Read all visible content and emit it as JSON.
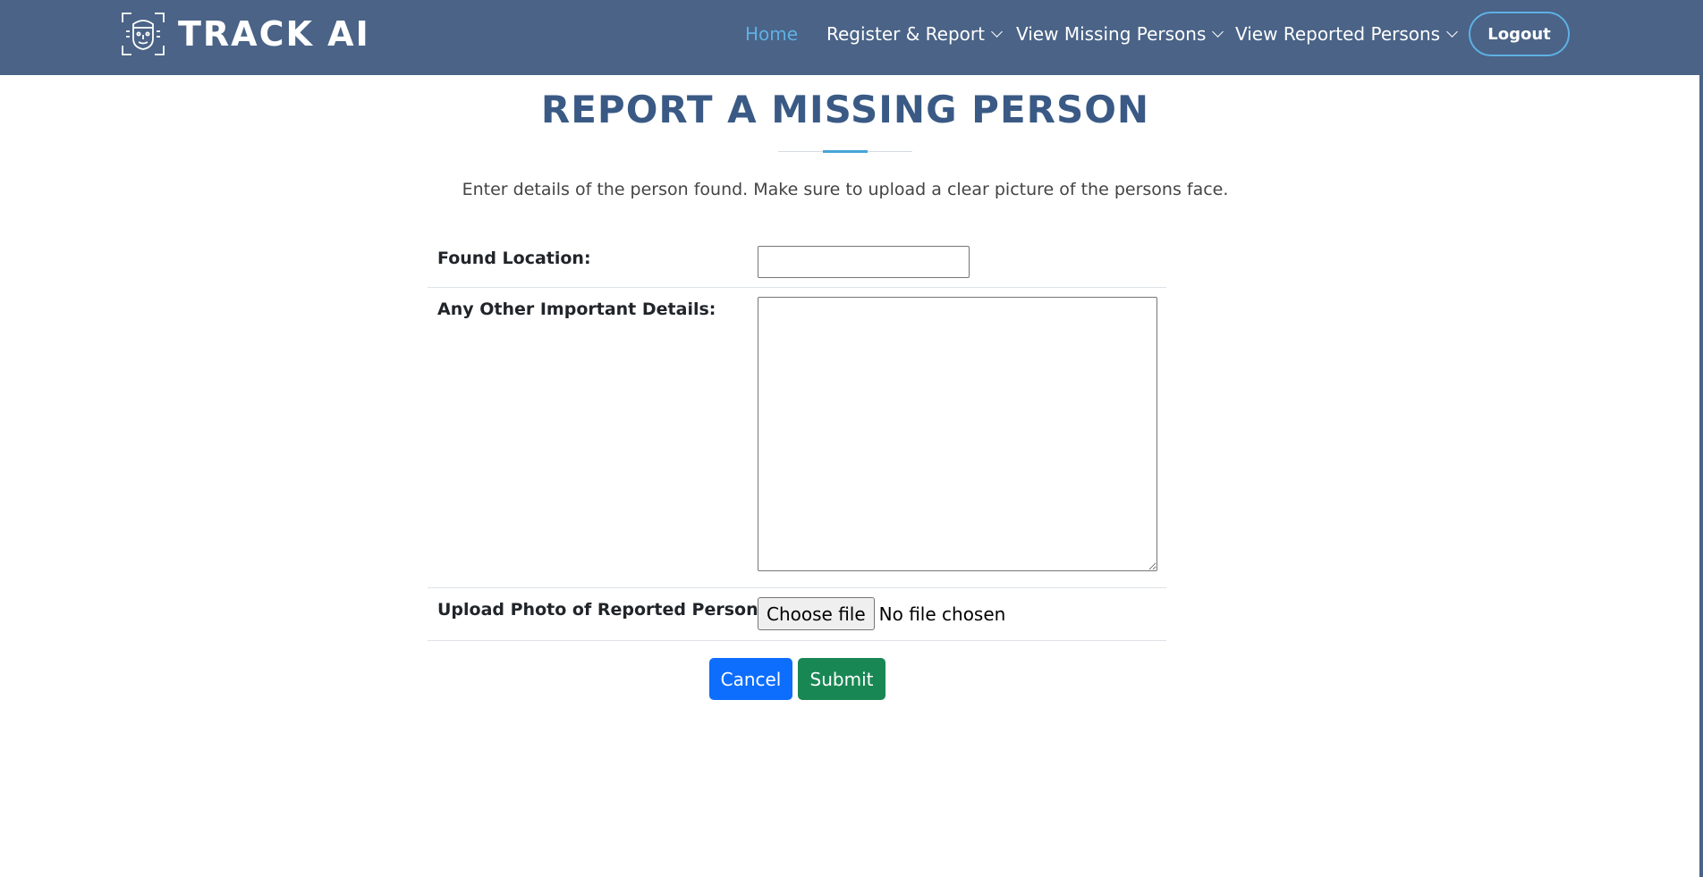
{
  "brand": {
    "name": "TRACK AI",
    "icon": "face-scan-icon"
  },
  "nav": {
    "items": [
      {
        "label": "Home",
        "active": true
      },
      {
        "label": "Register & Report",
        "dropdown": true
      },
      {
        "label": "View Missing Persons",
        "dropdown": true
      },
      {
        "label": "View Reported Persons",
        "dropdown": true
      }
    ],
    "logout_label": "Logout"
  },
  "page": {
    "title": "REPORT A MISSING PERSON",
    "subtitle": "Enter details of the person found. Make sure to upload a clear picture of the persons face."
  },
  "form": {
    "found_location": {
      "label": "Found Location:",
      "value": ""
    },
    "details": {
      "label": "Any Other Important Details:",
      "value": ""
    },
    "photo": {
      "label": "Upload Photo of Reported Person:",
      "button_label": "Choose file",
      "status": "No file chosen"
    },
    "cancel_label": "Cancel",
    "submit_label": "Submit"
  },
  "colors": {
    "header_bg": "#4a6387",
    "nav_active": "#5fb0e4",
    "title": "#3a5a85",
    "accent": "#47a5d8",
    "cancel": "#0d6efd",
    "submit": "#198754"
  }
}
